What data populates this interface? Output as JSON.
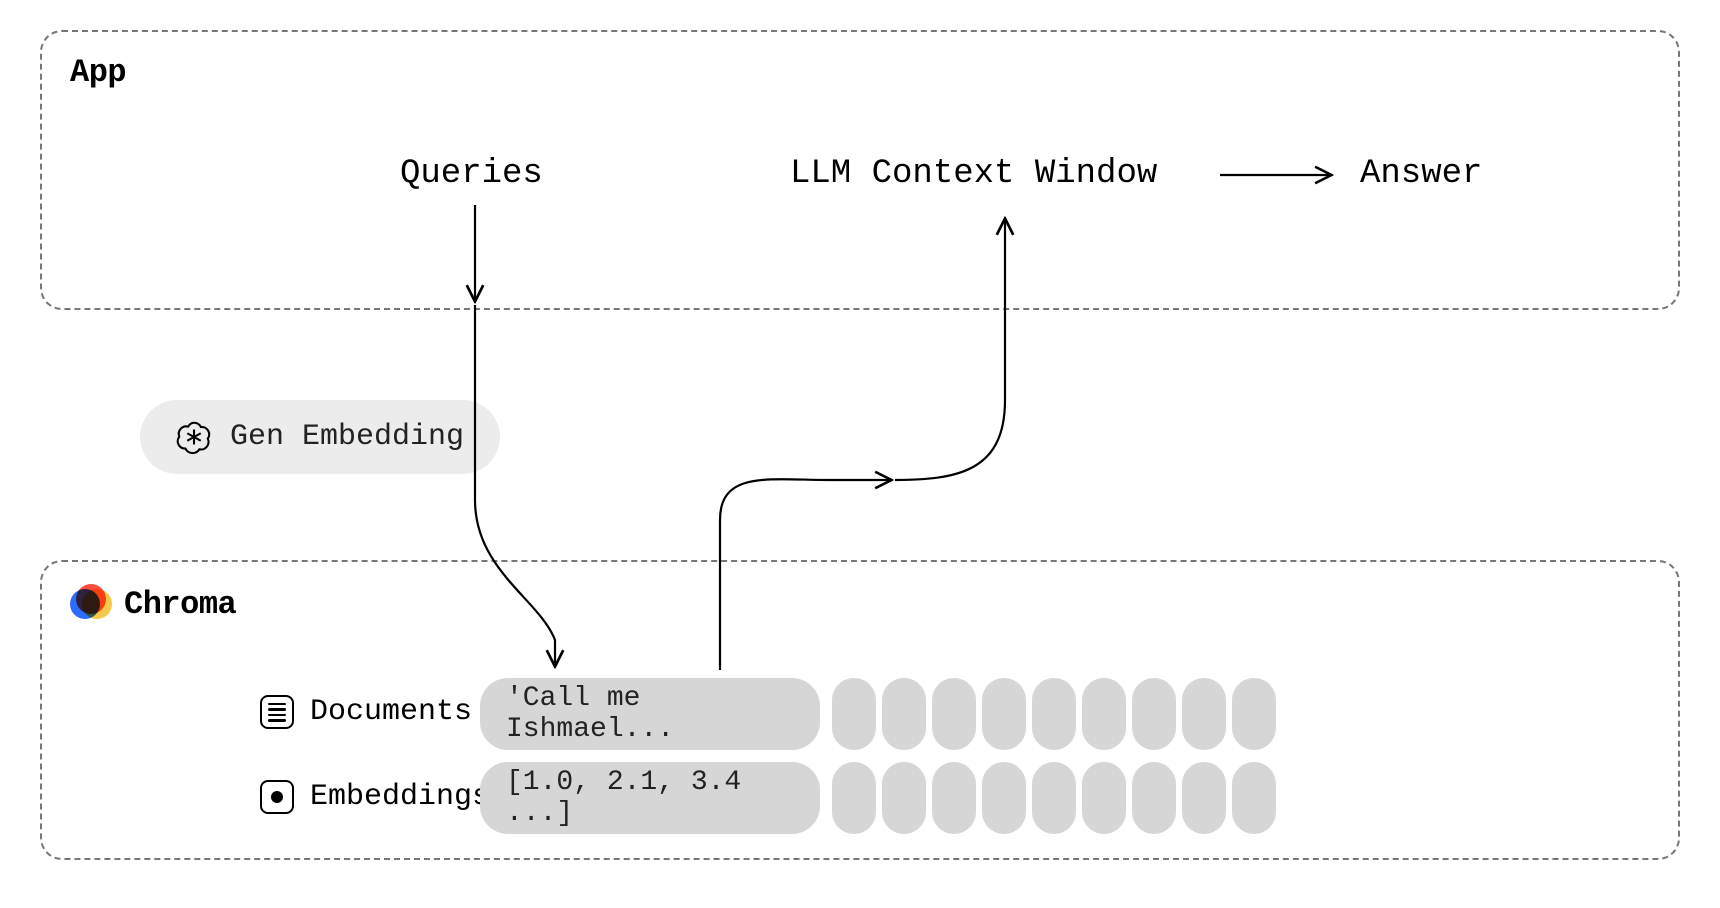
{
  "app": {
    "title": "App",
    "queries_label": "Queries",
    "llm_context_label": "LLM Context Window",
    "answer_label": "Answer"
  },
  "gen_embedding": {
    "label": "Gen Embedding"
  },
  "chroma": {
    "title": "Chroma",
    "documents_label": "Documents",
    "embeddings_label": "Embeddings",
    "document_sample": "'Call me Ishmael...",
    "embedding_sample": "[1.0, 2.1, 3.4 ...]",
    "extra_column_count": 9
  }
}
